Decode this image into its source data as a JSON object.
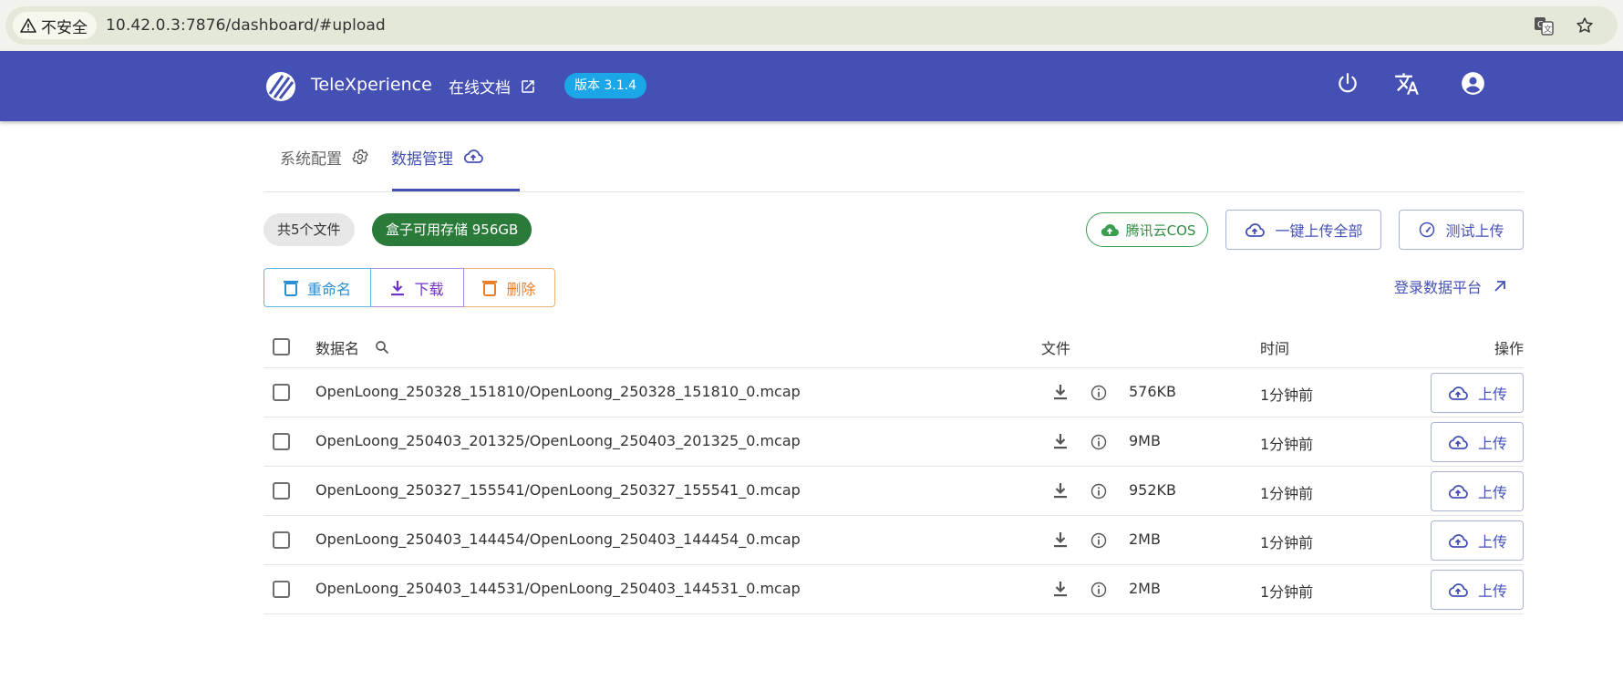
{
  "browser": {
    "security_label": "不安全",
    "url": "10.42.0.3:7876/dashboard/#upload",
    "icons": [
      "warning-triangle-icon",
      "translate-page-icon",
      "bookmark-star-icon"
    ]
  },
  "header": {
    "brand": "TeleXperience",
    "docs_link": "在线文档",
    "version": "版本 3.1.4",
    "icons": [
      "power-icon",
      "translate-icon",
      "account-icon"
    ],
    "colors": {
      "background": "#4550b5",
      "version_badge": "#1ba6e8"
    }
  },
  "tabs": [
    {
      "label": "系统配置",
      "icon": "gear-icon",
      "active": false
    },
    {
      "label": "数据管理",
      "icon": "cloud-upload-icon",
      "active": true
    }
  ],
  "summary": {
    "file_count": "共5个文件",
    "storage": "盒子可用存储 956GB"
  },
  "actions": {
    "cos": "腾讯云COS",
    "upload_all": "一键上传全部",
    "test_upload": "测试上传",
    "rename": "重命名",
    "download": "下载",
    "delete": "删除",
    "platform_login": "登录数据平台"
  },
  "table": {
    "columns": {
      "name": "数据名",
      "file": "文件",
      "time": "时间",
      "op": "操作"
    },
    "upload_label": "上传",
    "rows": [
      {
        "name": "OpenLoong_250328_151810/OpenLoong_250328_151810_0.mcap",
        "size": "576KB",
        "time": "1分钟前"
      },
      {
        "name": "OpenLoong_250403_201325/OpenLoong_250403_201325_0.mcap",
        "size": "9MB",
        "time": "1分钟前"
      },
      {
        "name": "OpenLoong_250327_155541/OpenLoong_250327_155541_0.mcap",
        "size": "952KB",
        "time": "1分钟前"
      },
      {
        "name": "OpenLoong_250403_144454/OpenLoong_250403_144454_0.mcap",
        "size": "2MB",
        "time": "1分钟前"
      },
      {
        "name": "OpenLoong_250403_144531/OpenLoong_250403_144531_0.mcap",
        "size": "2MB",
        "time": "1分钟前"
      }
    ]
  }
}
